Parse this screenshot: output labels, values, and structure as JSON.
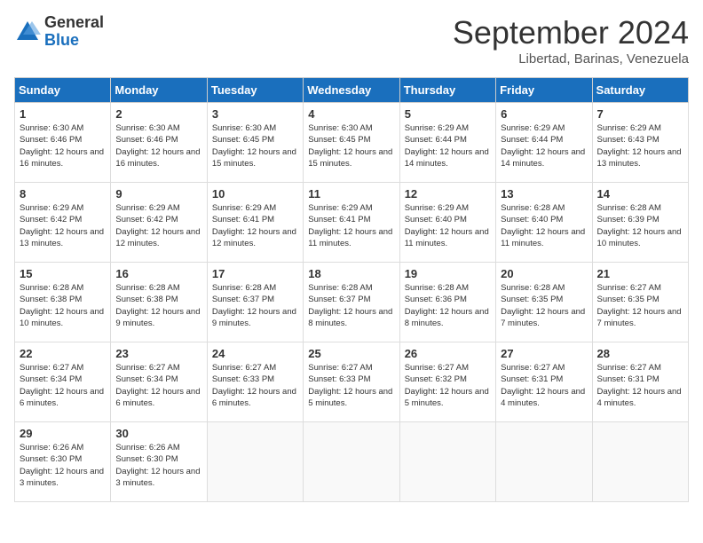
{
  "logo": {
    "general": "General",
    "blue": "Blue"
  },
  "title": "September 2024",
  "location": "Libertad, Barinas, Venezuela",
  "days_header": [
    "Sunday",
    "Monday",
    "Tuesday",
    "Wednesday",
    "Thursday",
    "Friday",
    "Saturday"
  ],
  "weeks": [
    [
      {
        "day": "1",
        "sunrise": "Sunrise: 6:30 AM",
        "sunset": "Sunset: 6:46 PM",
        "daylight": "Daylight: 12 hours and 16 minutes."
      },
      {
        "day": "2",
        "sunrise": "Sunrise: 6:30 AM",
        "sunset": "Sunset: 6:46 PM",
        "daylight": "Daylight: 12 hours and 16 minutes."
      },
      {
        "day": "3",
        "sunrise": "Sunrise: 6:30 AM",
        "sunset": "Sunset: 6:45 PM",
        "daylight": "Daylight: 12 hours and 15 minutes."
      },
      {
        "day": "4",
        "sunrise": "Sunrise: 6:30 AM",
        "sunset": "Sunset: 6:45 PM",
        "daylight": "Daylight: 12 hours and 15 minutes."
      },
      {
        "day": "5",
        "sunrise": "Sunrise: 6:29 AM",
        "sunset": "Sunset: 6:44 PM",
        "daylight": "Daylight: 12 hours and 14 minutes."
      },
      {
        "day": "6",
        "sunrise": "Sunrise: 6:29 AM",
        "sunset": "Sunset: 6:44 PM",
        "daylight": "Daylight: 12 hours and 14 minutes."
      },
      {
        "day": "7",
        "sunrise": "Sunrise: 6:29 AM",
        "sunset": "Sunset: 6:43 PM",
        "daylight": "Daylight: 12 hours and 13 minutes."
      }
    ],
    [
      {
        "day": "8",
        "sunrise": "Sunrise: 6:29 AM",
        "sunset": "Sunset: 6:42 PM",
        "daylight": "Daylight: 12 hours and 13 minutes."
      },
      {
        "day": "9",
        "sunrise": "Sunrise: 6:29 AM",
        "sunset": "Sunset: 6:42 PM",
        "daylight": "Daylight: 12 hours and 12 minutes."
      },
      {
        "day": "10",
        "sunrise": "Sunrise: 6:29 AM",
        "sunset": "Sunset: 6:41 PM",
        "daylight": "Daylight: 12 hours and 12 minutes."
      },
      {
        "day": "11",
        "sunrise": "Sunrise: 6:29 AM",
        "sunset": "Sunset: 6:41 PM",
        "daylight": "Daylight: 12 hours and 11 minutes."
      },
      {
        "day": "12",
        "sunrise": "Sunrise: 6:29 AM",
        "sunset": "Sunset: 6:40 PM",
        "daylight": "Daylight: 12 hours and 11 minutes."
      },
      {
        "day": "13",
        "sunrise": "Sunrise: 6:28 AM",
        "sunset": "Sunset: 6:40 PM",
        "daylight": "Daylight: 12 hours and 11 minutes."
      },
      {
        "day": "14",
        "sunrise": "Sunrise: 6:28 AM",
        "sunset": "Sunset: 6:39 PM",
        "daylight": "Daylight: 12 hours and 10 minutes."
      }
    ],
    [
      {
        "day": "15",
        "sunrise": "Sunrise: 6:28 AM",
        "sunset": "Sunset: 6:38 PM",
        "daylight": "Daylight: 12 hours and 10 minutes."
      },
      {
        "day": "16",
        "sunrise": "Sunrise: 6:28 AM",
        "sunset": "Sunset: 6:38 PM",
        "daylight": "Daylight: 12 hours and 9 minutes."
      },
      {
        "day": "17",
        "sunrise": "Sunrise: 6:28 AM",
        "sunset": "Sunset: 6:37 PM",
        "daylight": "Daylight: 12 hours and 9 minutes."
      },
      {
        "day": "18",
        "sunrise": "Sunrise: 6:28 AM",
        "sunset": "Sunset: 6:37 PM",
        "daylight": "Daylight: 12 hours and 8 minutes."
      },
      {
        "day": "19",
        "sunrise": "Sunrise: 6:28 AM",
        "sunset": "Sunset: 6:36 PM",
        "daylight": "Daylight: 12 hours and 8 minutes."
      },
      {
        "day": "20",
        "sunrise": "Sunrise: 6:28 AM",
        "sunset": "Sunset: 6:35 PM",
        "daylight": "Daylight: 12 hours and 7 minutes."
      },
      {
        "day": "21",
        "sunrise": "Sunrise: 6:27 AM",
        "sunset": "Sunset: 6:35 PM",
        "daylight": "Daylight: 12 hours and 7 minutes."
      }
    ],
    [
      {
        "day": "22",
        "sunrise": "Sunrise: 6:27 AM",
        "sunset": "Sunset: 6:34 PM",
        "daylight": "Daylight: 12 hours and 6 minutes."
      },
      {
        "day": "23",
        "sunrise": "Sunrise: 6:27 AM",
        "sunset": "Sunset: 6:34 PM",
        "daylight": "Daylight: 12 hours and 6 minutes."
      },
      {
        "day": "24",
        "sunrise": "Sunrise: 6:27 AM",
        "sunset": "Sunset: 6:33 PM",
        "daylight": "Daylight: 12 hours and 6 minutes."
      },
      {
        "day": "25",
        "sunrise": "Sunrise: 6:27 AM",
        "sunset": "Sunset: 6:33 PM",
        "daylight": "Daylight: 12 hours and 5 minutes."
      },
      {
        "day": "26",
        "sunrise": "Sunrise: 6:27 AM",
        "sunset": "Sunset: 6:32 PM",
        "daylight": "Daylight: 12 hours and 5 minutes."
      },
      {
        "day": "27",
        "sunrise": "Sunrise: 6:27 AM",
        "sunset": "Sunset: 6:31 PM",
        "daylight": "Daylight: 12 hours and 4 minutes."
      },
      {
        "day": "28",
        "sunrise": "Sunrise: 6:27 AM",
        "sunset": "Sunset: 6:31 PM",
        "daylight": "Daylight: 12 hours and 4 minutes."
      }
    ],
    [
      {
        "day": "29",
        "sunrise": "Sunrise: 6:26 AM",
        "sunset": "Sunset: 6:30 PM",
        "daylight": "Daylight: 12 hours and 3 minutes."
      },
      {
        "day": "30",
        "sunrise": "Sunrise: 6:26 AM",
        "sunset": "Sunset: 6:30 PM",
        "daylight": "Daylight: 12 hours and 3 minutes."
      },
      null,
      null,
      null,
      null,
      null
    ]
  ]
}
